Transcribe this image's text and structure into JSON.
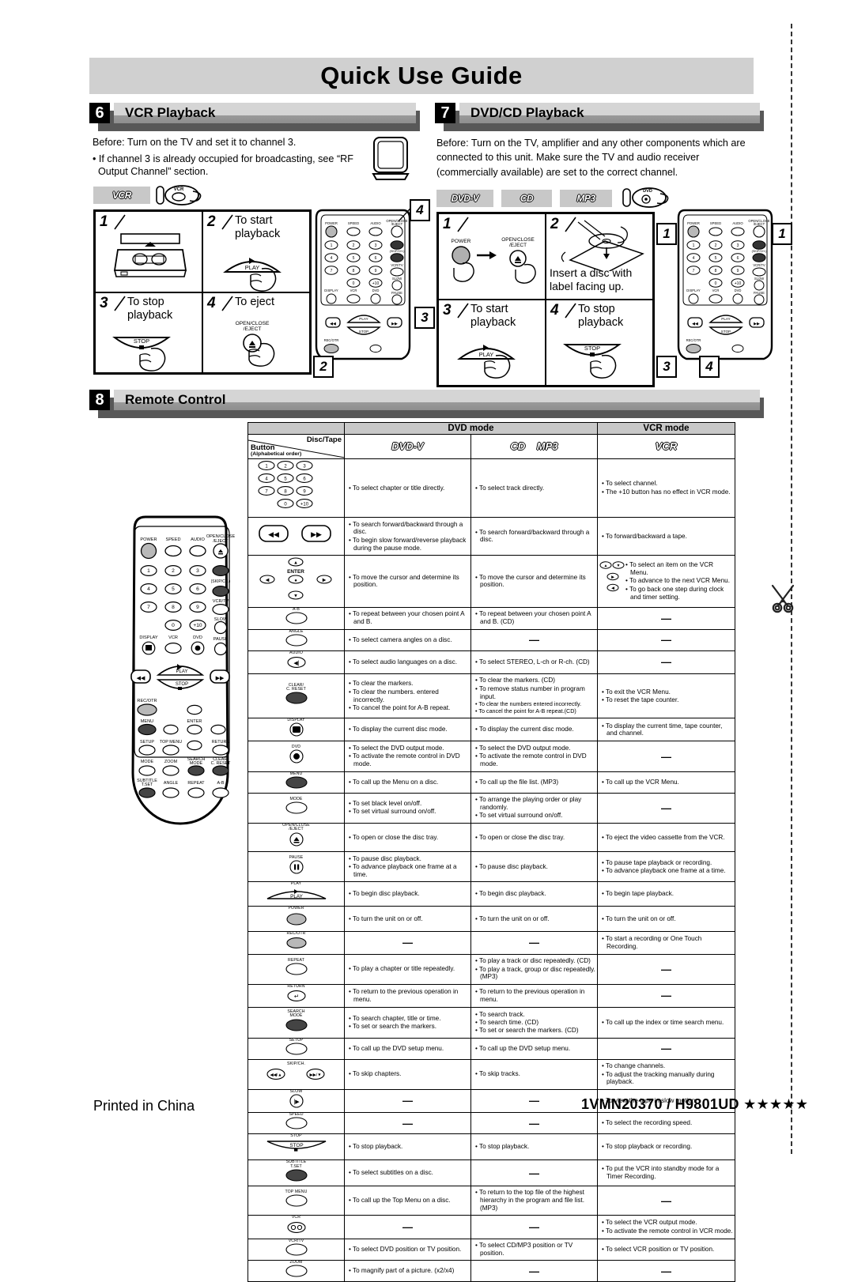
{
  "page": {
    "title": "Quick Use Guide",
    "printed_in": "Printed in China",
    "part_number": "1VMN20370 / H9801UD ★★★★★"
  },
  "sections": {
    "vcr_playback": {
      "number": "6",
      "title": "VCR Playback",
      "before": "Before:  Turn on the TV and set it to channel 3.",
      "note": "• If channel 3 is already occupied for broadcasting, see “RF Output Channel” section.",
      "badges": [
        "VCR"
      ],
      "steps": [
        {
          "num": "1",
          "text": ""
        },
        {
          "num": "2",
          "text": "To start\nplayback"
        },
        {
          "num": "3",
          "text": "To stop\nplayback"
        },
        {
          "num": "4",
          "text": "To eject"
        }
      ],
      "button_labels": {
        "play": "PLAY",
        "stop": "STOP",
        "eject": "OPEN/CLOSE\n/EJECT"
      },
      "callouts": [
        "4",
        "2"
      ]
    },
    "dvd_playback": {
      "number": "7",
      "title": "DVD/CD Playback",
      "before": "Before: Turn on the TV, amplifier and any other components which are connected to this unit. Make sure the TV and audio receiver (commercially available) are set to the correct channel.",
      "badges": [
        "DVD-V",
        "CD",
        "MP3"
      ],
      "steps": [
        {
          "num": "1",
          "text": ""
        },
        {
          "num": "2",
          "text": "Insert a disc with\nlabel facing up."
        },
        {
          "num": "3",
          "text": "To start\nplayback"
        },
        {
          "num": "4",
          "text": "To stop\nplayback"
        }
      ],
      "button_labels": {
        "power": "POWER",
        "eject": "OPEN/CLOSE\n/EJECT",
        "play": "PLAY",
        "stop": "STOP"
      },
      "callouts": [
        "1",
        "1",
        "3",
        "4"
      ]
    },
    "remote_control": {
      "number": "8",
      "title": "Remote Control"
    }
  },
  "remote_keys": {
    "power": "POWER",
    "speed": "SPEED",
    "audio": "AUDIO",
    "open_close_eject": "OPEN/CLOSE\n/EJECT",
    "skip_ch": "(SKIP/CH.)",
    "vcr_tv": "VCR/TV",
    "slow": "SLOW",
    "display": "DISPLAY",
    "vcr": "VCR",
    "dvd": "DVD",
    "pause": "PAUSE",
    "play": "PLAY",
    "stop": "STOP",
    "rec_otr": "REC/OTR",
    "menu": "MENU",
    "enter": "ENTER",
    "setup": "SETUP",
    "top_menu": "TOP MENU",
    "return": "RETURN",
    "mode": "MODE",
    "zoom": "ZOOM",
    "search_mode": "SEARCH\nMODE",
    "clear_reset": "CLEAR/\nC. RESET",
    "subtitle": "SUBTITLE\nT.SET",
    "angle": "ANGLE",
    "repeat": "REPEAT",
    "ab": "A-B",
    "numbers": [
      "1",
      "2",
      "3",
      "4",
      "5",
      "6",
      "7",
      "8",
      "9",
      "0",
      "+10"
    ]
  },
  "table": {
    "header": {
      "corner_disc_tape": "Disc/Tape",
      "corner_button": "Button",
      "corner_order": "(Alphabetical order)",
      "dvd_mode": "DVD mode",
      "vcr_mode": "VCR mode",
      "logo_dvd": "DVD-V",
      "logo_cd": "CD",
      "logo_mp3": "MP3",
      "logo_vcr": "VCR"
    },
    "rows": [
      {
        "button": "numbers",
        "dvd": [
          "To select chapter or title directly."
        ],
        "cd": [
          "To select track directly."
        ],
        "vcr": [
          "To select channel.",
          "The +10 button has no effect in VCR mode."
        ]
      },
      {
        "button": "rew-ff",
        "dvd": [
          "To search forward/backward through a disc.",
          "To begin slow forward/reverse playback during the pause mode."
        ],
        "cd": [
          "To search forward/backward through a disc."
        ],
        "vcr": [
          "To forward/backward a tape."
        ]
      },
      {
        "button": "cursor-enter",
        "label": "ENTER",
        "dvd": [
          "To move the cursor and determine its position."
        ],
        "cd": [
          "To move the cursor and determine its position."
        ],
        "vcr": [
          "To select an item on the VCR Menu.",
          "To advance to the next VCR Menu.",
          "To go back one step during clock and timer setting."
        ]
      },
      {
        "button": "ab",
        "label": "A-B",
        "dvd": [
          "To repeat between your chosen point A and B."
        ],
        "cd": [
          "To repeat between your chosen point A and B. (CD)"
        ],
        "vcr": []
      },
      {
        "button": "angle",
        "label": "ANGLE",
        "dvd": [
          "To select camera angles on a disc."
        ],
        "cd": [],
        "vcr": []
      },
      {
        "button": "audio",
        "label": "AUDIO",
        "dvd": [
          "To select audio languages on a disc."
        ],
        "cd": [
          "To select STEREO, L-ch or R-ch. (CD)"
        ],
        "vcr": []
      },
      {
        "button": "clear",
        "label": "CLEAR/\nC. RESET",
        "dvd": [
          "To clear the markers.",
          "To clear the numbers. entered incorrectly.",
          "To cancel the point for A-B repeat."
        ],
        "cd": [
          "To clear the markers. (CD)",
          "To remove status number in program input.",
          "To clear the numbers entered incorrectly.",
          "To cancel the point for A-B repeat.(CD)"
        ],
        "vcr": [
          "To exit the VCR Menu.",
          "To reset the tape counter."
        ]
      },
      {
        "button": "display",
        "label": "DISPLAY",
        "dvd": [
          "To display the current disc mode."
        ],
        "cd": [
          "To display the current disc mode."
        ],
        "vcr": [
          "To display the current time, tape counter, and channel."
        ]
      },
      {
        "button": "dvd",
        "label": "DVD",
        "dvd": [
          "To select the DVD output mode.",
          "To activate the remote control in DVD mode."
        ],
        "cd": [
          "To select the DVD output mode.",
          "To activate the remote control in DVD mode."
        ],
        "vcr": []
      },
      {
        "button": "menu",
        "label": "MENU",
        "dvd": [
          "To call up the Menu on a disc."
        ],
        "cd": [
          "To call up the file list. (MP3)"
        ],
        "vcr": [
          "To call up the VCR Menu."
        ]
      },
      {
        "button": "mode",
        "label": "MODE",
        "dvd": [
          "To set black level on/off.",
          "To set virtual surround on/off."
        ],
        "cd": [
          "To arrange the playing order or play randomly.",
          "To set virtual surround on/off."
        ],
        "vcr": []
      },
      {
        "button": "eject",
        "label": "OPEN/CLOSE\n/EJECT",
        "dvd": [
          "To open or close the disc tray."
        ],
        "cd": [
          "To open or close the disc tray."
        ],
        "vcr": [
          "To eject the video cassette from the VCR."
        ]
      },
      {
        "button": "pause",
        "label": "PAUSE",
        "dvd": [
          "To pause disc playback.",
          "To advance playback one frame at a time."
        ],
        "cd": [
          "To pause disc playback."
        ],
        "vcr": [
          "To pause tape playback or recording.",
          "To advance playback one frame at a time."
        ]
      },
      {
        "button": "play",
        "label": "PLAY",
        "dvd": [
          "To begin disc playback."
        ],
        "cd": [
          "To begin disc playback."
        ],
        "vcr": [
          "To begin tape playback."
        ]
      },
      {
        "button": "power",
        "label": "POWER",
        "dvd": [
          "To turn the unit on or off."
        ],
        "cd": [
          "To turn the unit on or off."
        ],
        "vcr": [
          "To turn the unit on or off."
        ]
      },
      {
        "button": "recotr",
        "label": "REC/OTR",
        "dvd": [],
        "cd": [],
        "vcr": [
          "To start a recording or One Touch Recording."
        ]
      },
      {
        "button": "repeat",
        "label": "REPEAT",
        "dvd": [
          "To play a chapter or title repeatedly."
        ],
        "cd": [
          "To play a track or disc repeatedly. (CD)",
          "To play a track, group or disc repeatedly. (MP3)"
        ],
        "vcr": []
      },
      {
        "button": "return",
        "label": "RETURN",
        "dvd": [
          "To return to the previous operation in menu."
        ],
        "cd": [
          "To return to the previous operation in menu."
        ],
        "vcr": []
      },
      {
        "button": "search",
        "label": "SEARCH\nMODE",
        "dvd": [
          "To search chapter, title or time.",
          "To set or search the markers."
        ],
        "cd": [
          "To search track.",
          "To search time. (CD)",
          "To set or search the markers. (CD)"
        ],
        "vcr": [
          "To call up the index or time search menu."
        ]
      },
      {
        "button": "setup",
        "label": "SETUP",
        "dvd": [
          "To call up the DVD setup menu."
        ],
        "cd": [
          "To call up the DVD setup menu."
        ],
        "vcr": []
      },
      {
        "button": "skip",
        "label": "SKIP/CH.",
        "dvd": [
          "To skip chapters."
        ],
        "cd": [
          "To skip tracks."
        ],
        "vcr": [
          "To change channels.",
          "To adjust the tracking manually during playback."
        ]
      },
      {
        "button": "slow",
        "label": "SLOW",
        "dvd": [],
        "cd": [],
        "vcr": [
          "To view the tape in slow motion."
        ]
      },
      {
        "button": "speed",
        "label": "SPEED",
        "dvd": [],
        "cd": [],
        "vcr": [
          "To select the recording speed."
        ]
      },
      {
        "button": "stop",
        "label": "STOP",
        "dvd": [
          "To stop playback."
        ],
        "cd": [
          "To stop playback."
        ],
        "vcr": [
          "To stop playback or recording."
        ]
      },
      {
        "button": "subtitle",
        "label": "SUBTITLE\nT.SET",
        "dvd": [
          "To select subtitles on a disc."
        ],
        "cd": [],
        "vcr": [
          "To put the VCR into standby mode for a Timer Recording."
        ]
      },
      {
        "button": "topmenu",
        "label": "TOP MENU",
        "dvd": [
          "To call up the Top Menu on a disc."
        ],
        "cd": [
          "To return to the top file of the highest hierarchy in the program and file list. (MP3)"
        ],
        "vcr": []
      },
      {
        "button": "vcr",
        "label": "VCR",
        "dvd": [],
        "cd": [],
        "vcr": [
          "To select the VCR output mode.",
          "To activate the remote control in VCR mode."
        ]
      },
      {
        "button": "vcrtv",
        "label": "VCR/TV",
        "dvd": [
          "To select DVD position or TV position."
        ],
        "cd": [
          "To select CD/MP3 position or TV position."
        ],
        "vcr": [
          "To select VCR position or TV position."
        ]
      },
      {
        "button": "zoom",
        "label": "ZOOM",
        "dvd": [
          "To magnify part of a picture. (x2/x4)"
        ],
        "cd": [],
        "vcr": []
      }
    ]
  }
}
